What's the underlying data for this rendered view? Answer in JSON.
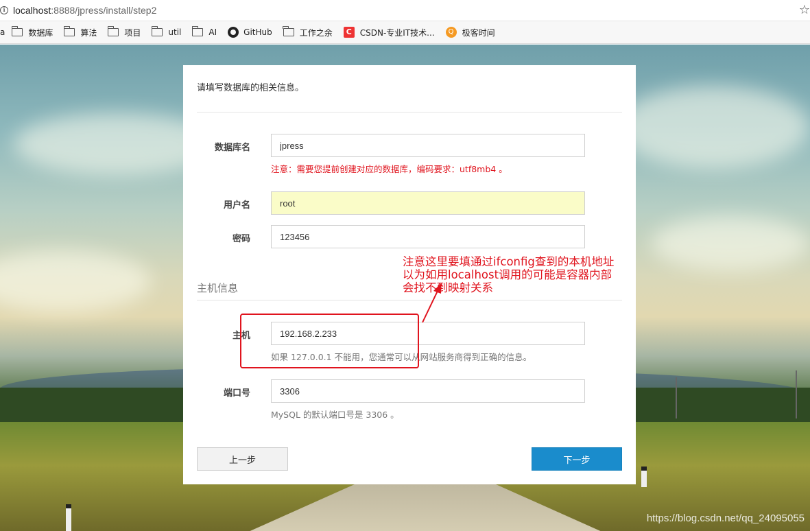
{
  "browser": {
    "url_host": "localhost",
    "url_rest": ":8888/jpress/install/step2",
    "bookmarks": [
      "数据库",
      "算法",
      "项目",
      "util",
      "AI",
      "GitHub",
      "工作之余",
      "CSDN-专业IT技术...",
      "极客时间"
    ],
    "partial_first": "a"
  },
  "form": {
    "intro": "请填写数据库的相关信息。",
    "db_name_label": "数据库名",
    "db_name_value": "jpress",
    "db_name_help": "注意：需要您提前创建对应的数据库，编码要求：utf8mb4 。",
    "user_label": "用户名",
    "user_value": "root",
    "password_label": "密码",
    "password_value": "123456",
    "section_title": "主机信息",
    "host_label": "主机",
    "host_value": "192.168.2.233",
    "host_help": "如果 127.0.0.1 不能用，您通常可以从网站服务商得到正确的信息。",
    "port_label": "端口号",
    "port_value": "3306",
    "port_help": "MySQL 的默认端口号是 3306 。",
    "prev_label": "上一步",
    "next_label": "下一步"
  },
  "annotation": {
    "text": "注意这里要填通过ifconfig查到的本机地址\n以为如用localhost调用的可能是容器内部\n会找不到映射关系",
    "color": "#e0141e"
  },
  "watermark": "https://blog.csdn.net/qq_24095055",
  "colors": {
    "next_button": "#1a8ccc",
    "autofill": "#fafcc8",
    "warning": "#e0141e"
  }
}
